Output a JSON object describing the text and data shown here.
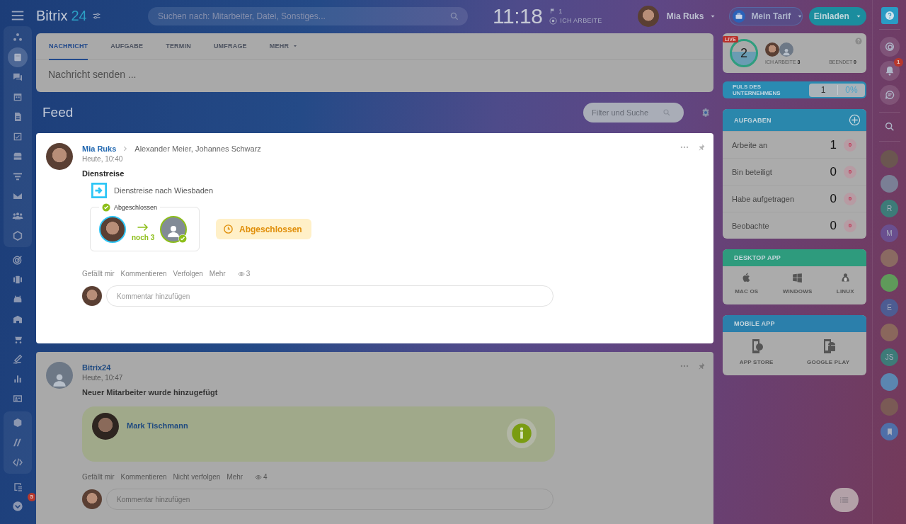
{
  "header": {
    "logo": {
      "name": "Bitrix",
      "number": "24"
    },
    "search": {
      "placeholder": "Suchen nach: Mitarbeiter, Datei, Sonstiges..."
    },
    "clock": "11:18",
    "flags": "1",
    "work_status": "ICH ARBEITE",
    "user": {
      "name": "Mia Ruks"
    },
    "tariff_button": "Mein Tarif",
    "invite_button": "Einladen"
  },
  "sidebar": {
    "groups": [
      {
        "panel": true,
        "items": [
          {
            "selected": false
          },
          {
            "selected": true
          },
          {
            "selected": false
          },
          {
            "selected": false
          },
          {
            "selected": false
          },
          {
            "selected": false
          },
          {
            "selected": false
          },
          {
            "selected": false
          },
          {
            "selected": false
          },
          {
            "selected": false
          },
          {
            "selected": false
          }
        ]
      },
      {
        "panel": false,
        "items": [
          {
            "selected": false
          },
          {
            "selected": false
          },
          {
            "selected": false
          },
          {
            "selected": false
          },
          {
            "selected": false
          },
          {
            "selected": false
          },
          {
            "selected": false
          },
          {
            "selected": false
          }
        ]
      },
      {
        "panel": true,
        "items": [
          {
            "selected": false
          },
          {
            "selected": false
          },
          {
            "selected": false
          }
        ]
      },
      {
        "panel": false,
        "items": [
          {
            "selected": false
          },
          {
            "selected": false,
            "badge": "5"
          }
        ]
      }
    ]
  },
  "composer": {
    "tabs": [
      {
        "label": "NACHRICHT",
        "selected": true,
        "kind": "tab"
      },
      {
        "label": "AUFGABE",
        "selected": false,
        "kind": "tab"
      },
      {
        "label": "TERMIN",
        "selected": false,
        "kind": "tab"
      },
      {
        "label": "UMFRAGE",
        "selected": false,
        "kind": "tab"
      },
      {
        "label": "MEHR",
        "selected": false,
        "kind": "menu"
      }
    ],
    "placeholder": "Nachricht senden ..."
  },
  "feed": {
    "title": "Feed",
    "filter": {
      "placeholder": "Filter und Suche"
    },
    "posts": [
      {
        "highlighted": true,
        "avatar": {
          "kind": "photo"
        },
        "author": "Mia Ruks",
        "recipients": "Alexander Meier, Johannes Schwarz",
        "time": "Heute, 10:40",
        "title": "Dienstreise",
        "kind": "workflow",
        "workflow": {
          "name": "Dienstreise nach Wiesbaden",
          "stage": "Abgeschlossen",
          "remaining": "noch 3",
          "status": "Abgeschlossen"
        },
        "actions": [
          "Gefällt mir",
          "Kommentieren",
          "Verfolgen",
          "Mehr"
        ],
        "views": "3",
        "comment": {
          "placeholder": "Kommentar hinzufügen"
        }
      },
      {
        "highlighted": false,
        "avatar": {
          "kind": "system"
        },
        "author": "Bitrix24",
        "time": "Heute, 10:47",
        "title": "Neuer Mitarbeiter wurde hinzugefügt",
        "kind": "new_employee",
        "employee": {
          "name": "Mark Tischmann"
        },
        "actions": [
          "Gefällt mir",
          "Kommentieren",
          "Nicht verfolgen",
          "Mehr"
        ],
        "views": "4",
        "comment": {
          "placeholder": "Kommentar hinzufügen"
        }
      }
    ]
  },
  "widgets": {
    "worktime": {
      "live": "LIVE",
      "count": "2",
      "working": "ICH ARBEITE **3**",
      "finished": "BEENDET **0**"
    },
    "pulse": {
      "title": "PULS DES UNTERNEHMENS",
      "value": "1",
      "percent": "0%"
    },
    "tasks": {
      "title": "AUFGABEN",
      "rows": [
        {
          "label": "Arbeite an",
          "count": "1",
          "badge": "0"
        },
        {
          "label": "Bin beteiligt",
          "count": "0",
          "badge": "0"
        },
        {
          "label": "Habe aufgetragen",
          "count": "0",
          "badge": "0"
        },
        {
          "label": "Beobachte",
          "count": "0",
          "badge": "0"
        }
      ]
    },
    "desktop_app": {
      "title": "DESKTOP APP",
      "items": [
        {
          "kind": "mac",
          "label": "MAC OS"
        },
        {
          "kind": "windows",
          "label": "WINDOWS"
        },
        {
          "kind": "linux",
          "label": "LINUX"
        }
      ]
    },
    "mobile_app": {
      "title": "MOBILE APP",
      "items": [
        {
          "kind": "ios",
          "label": "APP STORE"
        },
        {
          "kind": "android",
          "label": "GOOGLE PLAY"
        }
      ]
    }
  },
  "right_rail": {
    "notifications": "1",
    "contacts": [
      {
        "kind": "photo",
        "color": "#6b5650"
      },
      {
        "kind": "photo",
        "color": "#7a7f95"
      },
      {
        "kind": "initials",
        "initials": "R",
        "color": "#3d7b78"
      },
      {
        "kind": "initials",
        "initials": "M",
        "color": "#6a4f8f"
      },
      {
        "kind": "photo",
        "color": "#8a6a62"
      },
      {
        "kind": "photo",
        "color": "#5f9a5a"
      },
      {
        "kind": "initials",
        "initials": "E",
        "color": "#4d5c92"
      },
      {
        "kind": "photo",
        "color": "#8a675c"
      },
      {
        "kind": "initials",
        "initials": "JS",
        "color": "#3d7b78"
      },
      {
        "kind": "photo",
        "color": "#5b86b0"
      },
      {
        "kind": "photo",
        "color": "#7a5a55"
      },
      {
        "kind": "bookmark",
        "color": "#4f6fa8"
      }
    ]
  }
}
